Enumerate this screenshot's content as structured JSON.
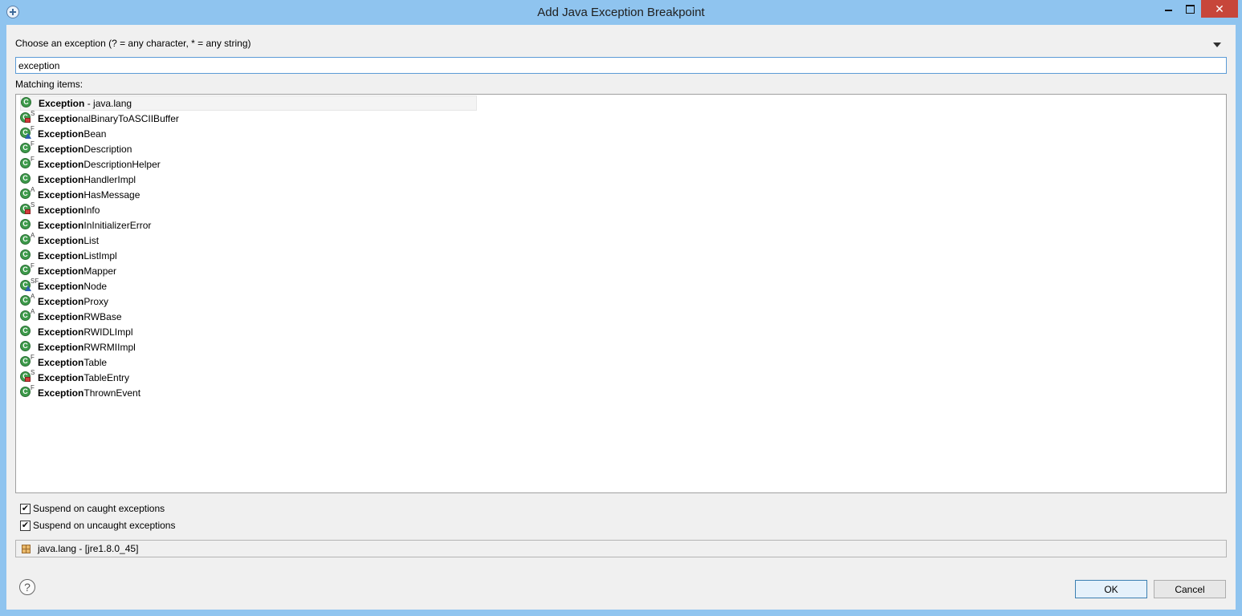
{
  "window": {
    "title": "Add Java Exception Breakpoint",
    "min_icon": "minimize-icon",
    "max_icon": "maximize-icon",
    "close_glyph": "✕"
  },
  "chooser": {
    "label": "Choose an exception (? = any character, * = any string)",
    "value": "exception",
    "matching_label": "Matching items:"
  },
  "items": [
    {
      "bold": "Exception",
      "rest": " - java.lang",
      "mark": "",
      "overlay": "none"
    },
    {
      "bold": "Exceptio",
      "rest": "nalBinaryToASCIIBuffer",
      "mark": "S",
      "overlay": "square"
    },
    {
      "bold": "Exception",
      "rest": "Bean",
      "mark": "F",
      "overlay": "triangle"
    },
    {
      "bold": "Exception",
      "rest": "Description",
      "mark": "F",
      "overlay": "none"
    },
    {
      "bold": "Exception",
      "rest": "DescriptionHelper",
      "mark": "F",
      "overlay": "none"
    },
    {
      "bold": "Exception",
      "rest": "HandlerImpl",
      "mark": "",
      "overlay": "none"
    },
    {
      "bold": "Exception",
      "rest": "HasMessage",
      "mark": "A",
      "overlay": "none"
    },
    {
      "bold": "Exception",
      "rest": "Info",
      "mark": "S",
      "overlay": "square"
    },
    {
      "bold": "Exception",
      "rest": "InInitializerError",
      "mark": "",
      "overlay": "none"
    },
    {
      "bold": "Exception",
      "rest": "List",
      "mark": "A",
      "overlay": "none"
    },
    {
      "bold": "Exception",
      "rest": "ListImpl",
      "mark": "",
      "overlay": "none"
    },
    {
      "bold": "Exception",
      "rest": "Mapper",
      "mark": "F",
      "overlay": "none"
    },
    {
      "bold": "Exception",
      "rest": "Node",
      "mark": "SF",
      "overlay": "triangle"
    },
    {
      "bold": "Exception",
      "rest": "Proxy",
      "mark": "A",
      "overlay": "none"
    },
    {
      "bold": "Exception",
      "rest": "RWBase",
      "mark": "A",
      "overlay": "none"
    },
    {
      "bold": "Exception",
      "rest": "RWIDLImpl",
      "mark": "",
      "overlay": "none"
    },
    {
      "bold": "Exception",
      "rest": "RWRMIImpl",
      "mark": "",
      "overlay": "none"
    },
    {
      "bold": "Exception",
      "rest": "Table",
      "mark": "F",
      "overlay": "none"
    },
    {
      "bold": "Exception",
      "rest": "TableEntry",
      "mark": "S",
      "overlay": "square"
    },
    {
      "bold": "Exception",
      "rest": "ThrownEvent",
      "mark": "F",
      "overlay": "none"
    }
  ],
  "options": {
    "caught_label": "Suspend on caught exceptions",
    "caught_checked": true,
    "uncaught_label": "Suspend on uncaught exceptions",
    "uncaught_checked": true,
    "check_glyph": "✔"
  },
  "package": {
    "label": "java.lang - [jre1.8.0_45]",
    "icon": "package-icon"
  },
  "buttons": {
    "help_glyph": "?",
    "ok": "OK",
    "cancel": "Cancel"
  }
}
